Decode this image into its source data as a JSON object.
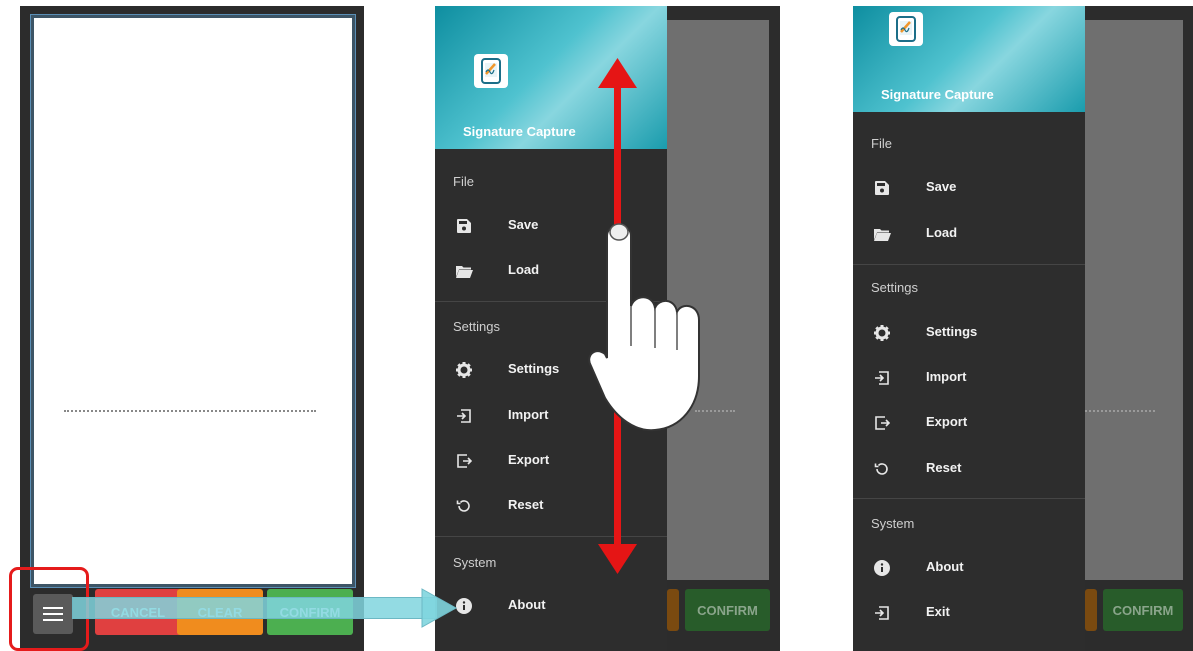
{
  "app": {
    "title": "Signature Capture"
  },
  "buttons": {
    "cancel": "CANCEL",
    "clear": "CLEAR",
    "confirm": "CONFIRM"
  },
  "drawer_full": {
    "sections": [
      {
        "label": "File",
        "items": [
          {
            "label": "Save",
            "icon": "save-icon"
          },
          {
            "label": "Load",
            "icon": "folder-open-icon"
          }
        ]
      },
      {
        "label": "Settings",
        "items": [
          {
            "label": "Settings",
            "icon": "gear-icon"
          },
          {
            "label": "Import",
            "icon": "import-icon"
          },
          {
            "label": "Export",
            "icon": "export-icon"
          },
          {
            "label": "Reset",
            "icon": "reset-icon"
          }
        ]
      },
      {
        "label": "System",
        "items": [
          {
            "label": "About",
            "icon": "info-icon"
          },
          {
            "label": "Exit",
            "icon": "exit-icon"
          }
        ]
      }
    ]
  },
  "colors": {
    "cancel": "#e04040",
    "clear": "#f08c1e",
    "confirm": "#4caf50",
    "drawer_bg": "#2d2d2d",
    "header_accent": "#1a9cad",
    "annotation_red": "#e51b1b"
  }
}
